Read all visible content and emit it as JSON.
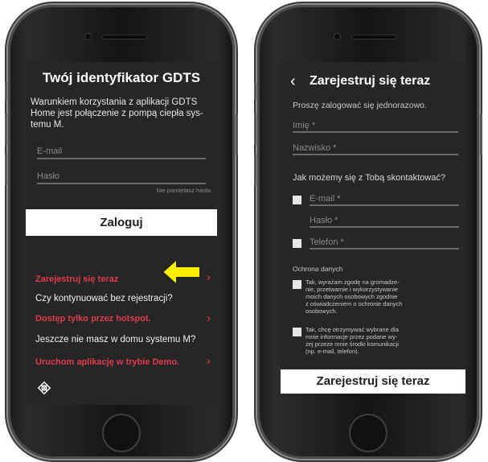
{
  "left_screen": {
    "title": "Twój identyfikator GDTS",
    "description_lines": [
      "Warunkiem korzystania z  aplikacji GDTS",
      "Home jest połączenie z pompą ciepła sys-",
      "temu M."
    ],
    "email_placeholder": "E-mail",
    "password_placeholder": "Hasło",
    "forgot_password": "Nie pamiętasz hasła",
    "login_button": "Zaloguj",
    "register_link": "Zarejestruj się teraz",
    "continue_question": "Czy kontynuować bez rejestracji?",
    "hotspot_link": "Dostęp tylko przez hotspot.",
    "no_system_question": "Jeszcze nie masz w domu systemu M?",
    "demo_link": "Uruchom aplikację w trybie Demo.",
    "chevron": "›"
  },
  "right_screen": {
    "back_glyph": "‹",
    "title": "Zarejestruj się teraz",
    "subtitle": "Proszę zalogować się jednorazowo.",
    "first_name_placeholder": "Imię *",
    "last_name_placeholder": "Nazwisko *",
    "contact_question": "Jak możemy się z Tobą skontaktować?",
    "email_placeholder": "E-mail *",
    "password_placeholder": "Hasło *",
    "phone_placeholder": "Telefon *",
    "data_protection_heading": "Ochrona danych",
    "consent_1_lines": [
      "Tak, wyrażam zgodę na gromadze-",
      "nie, przetwarnie i wykorzystywanie",
      "moich danych osobowych zgodnie",
      "z oświadczeniem o ochronie danych",
      "osobowych."
    ],
    "consent_2_lines": [
      "Tak, chcę otrzymywać wybrane dla",
      "mnie informacje przez podane wy-",
      "żej przeze mnie środki komunikacji",
      "(np. e-mail, telefon)."
    ],
    "register_button": "Zarejestruj się teraz"
  },
  "colors": {
    "screen_bg": "#262626",
    "accent_red": "#e03a4e",
    "arrow_yellow": "#ffee00"
  },
  "icons": {
    "logo": "knot-logo-icon",
    "annotation": "yellow-arrow-icon"
  }
}
